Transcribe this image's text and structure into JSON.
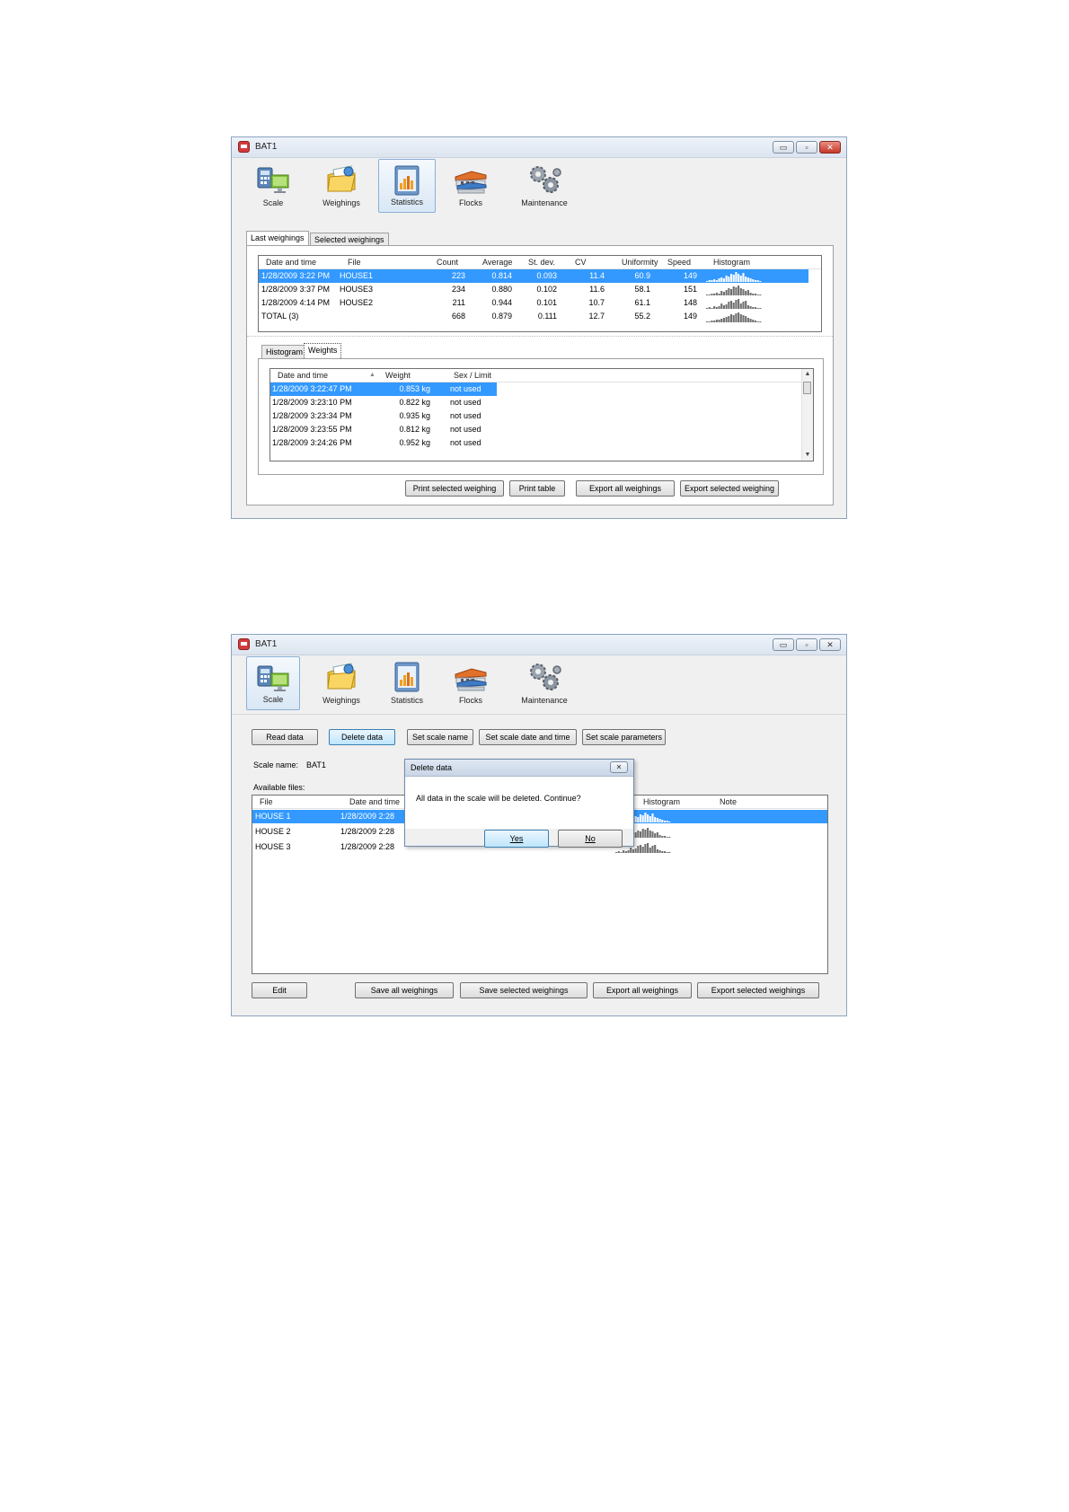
{
  "window1": {
    "title": "BAT1",
    "controls": {
      "minimize": "▭",
      "maximize": "▫",
      "close": "✕"
    },
    "toolbar": [
      {
        "label": "Scale",
        "icon": "scale-icon"
      },
      {
        "label": "Weighings",
        "icon": "weighings-icon"
      },
      {
        "label": "Statistics",
        "icon": "statistics-icon"
      },
      {
        "label": "Flocks",
        "icon": "flocks-icon"
      },
      {
        "label": "Maintenance",
        "icon": "maintenance-icon"
      }
    ],
    "active_toolbar": "Statistics",
    "tabs": [
      "Last weighings",
      "Selected weighings"
    ],
    "stats_table": {
      "columns": [
        "Date and time",
        "File",
        "Count",
        "Average",
        "St. dev.",
        "CV",
        "Uniformity",
        "Speed",
        "Histogram"
      ],
      "rows": [
        {
          "date": "1/28/2009 3:22 PM",
          "file": "HOUSE1",
          "count": "223",
          "average": "0.814",
          "stdev": "0.093",
          "cv": "11.4",
          "uniformity": "60.9",
          "speed": "149",
          "histogram": [
            1,
            2,
            2,
            3,
            2,
            4,
            5,
            4,
            7,
            6,
            9,
            8,
            11,
            9,
            7,
            10,
            6,
            5,
            4,
            3,
            2,
            2,
            1
          ]
        },
        {
          "date": "1/28/2009 3:37 PM",
          "file": "HOUSE3",
          "count": "234",
          "average": "0.880",
          "stdev": "0.102",
          "cv": "11.6",
          "uniformity": "58.1",
          "speed": "151",
          "histogram": [
            1,
            1,
            2,
            2,
            3,
            2,
            5,
            4,
            6,
            8,
            7,
            10,
            9,
            11,
            8,
            7,
            5,
            6,
            3,
            2,
            2,
            1,
            1
          ]
        },
        {
          "date": "1/28/2009 4:14 PM",
          "file": "HOUSE2",
          "count": "211",
          "average": "0.944",
          "stdev": "0.101",
          "cv": "10.7",
          "uniformity": "61.1",
          "speed": "148",
          "histogram": [
            1,
            2,
            1,
            3,
            2,
            3,
            6,
            4,
            5,
            8,
            9,
            7,
            10,
            11,
            6,
            8,
            9,
            4,
            3,
            2,
            2,
            1,
            1
          ]
        },
        {
          "date": "TOTAL (3)",
          "file": "",
          "count": "668",
          "average": "0.879",
          "stdev": "0.111",
          "cv": "12.7",
          "uniformity": "55.2",
          "speed": "149",
          "histogram": [
            1,
            1,
            2,
            2,
            3,
            3,
            4,
            5,
            6,
            7,
            9,
            8,
            10,
            11,
            9,
            8,
            7,
            5,
            4,
            3,
            2,
            1,
            1
          ]
        }
      ]
    },
    "subtabs": [
      "Histogram",
      "Weights"
    ],
    "weights_table": {
      "columns": [
        "Date and time",
        "Weight",
        "Sex / Limit"
      ],
      "rows": [
        {
          "time": "1/28/2009 3:22:47 PM",
          "weight": "0.853 kg",
          "sex": "not used"
        },
        {
          "time": "1/28/2009 3:23:10 PM",
          "weight": "0.822 kg",
          "sex": "not used"
        },
        {
          "time": "1/28/2009 3:23:34 PM",
          "weight": "0.935 kg",
          "sex": "not used"
        },
        {
          "time": "1/28/2009 3:23:55 PM",
          "weight": "0.812 kg",
          "sex": "not used"
        },
        {
          "time": "1/28/2009 3:24:26 PM",
          "weight": "0.952 kg",
          "sex": "not used"
        }
      ]
    },
    "buttons": [
      "Print selected weighing",
      "Print table",
      "Export all weighings",
      "Export selected weighing"
    ]
  },
  "window2": {
    "title": "BAT1",
    "controls": {
      "minimize": "▭",
      "maximize": "▫",
      "close": "✕"
    },
    "toolbar": [
      {
        "label": "Scale",
        "icon": "scale-icon"
      },
      {
        "label": "Weighings",
        "icon": "weighings-icon"
      },
      {
        "label": "Statistics",
        "icon": "statistics-icon"
      },
      {
        "label": "Flocks",
        "icon": "flocks-icon"
      },
      {
        "label": "Maintenance",
        "icon": "maintenance-icon"
      }
    ],
    "active_toolbar": "Scale",
    "top_buttons": [
      "Read data",
      "Delete data",
      "Set scale name",
      "Set scale date and time",
      "Set scale parameters"
    ],
    "scale_name_label": "Scale name:",
    "scale_name_value": "BAT1",
    "available_files_label": "Available files:",
    "files_table": {
      "columns": [
        "File",
        "Date and time",
        "Histogram",
        "Note"
      ],
      "rows": [
        {
          "file": "HOUSE 1",
          "date": "1/28/2009 2:28",
          "histogram": [
            1,
            2,
            2,
            3,
            2,
            4,
            5,
            4,
            7,
            6,
            9,
            8,
            11,
            9,
            7,
            10,
            6,
            5,
            4,
            3,
            2,
            2,
            1
          ]
        },
        {
          "file": "HOUSE 2",
          "date": "1/28/2009 2:28",
          "histogram": [
            1,
            1,
            2,
            2,
            3,
            2,
            5,
            4,
            6,
            8,
            7,
            10,
            9,
            11,
            8,
            7,
            5,
            6,
            3,
            2,
            2,
            1,
            1
          ]
        },
        {
          "file": "HOUSE 3",
          "date": "1/28/2009 2:28",
          "histogram": [
            1,
            2,
            1,
            3,
            2,
            3,
            6,
            4,
            5,
            8,
            9,
            7,
            10,
            11,
            6,
            8,
            9,
            4,
            3,
            2,
            2,
            1,
            1
          ]
        }
      ]
    },
    "bottom_buttons": [
      "Edit",
      "Save all weighings",
      "Save selected weighings",
      "Export all weighings",
      "Export selected weighings"
    ],
    "dialog": {
      "title": "Delete data",
      "close": "✕",
      "message": "All data in the scale will be deleted. Continue?",
      "yes": "Yes",
      "no": "No"
    }
  },
  "colors": {
    "selection": "#3399ff",
    "histogram_dark": "#707070",
    "histogram_light": "#ffffff"
  }
}
